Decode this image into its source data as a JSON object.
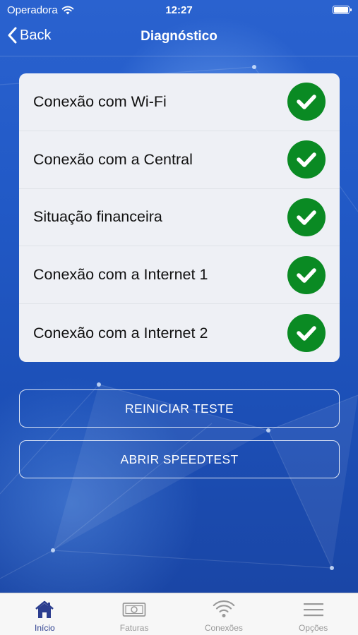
{
  "status_bar": {
    "carrier": "Operadora",
    "time": "12:27"
  },
  "navbar": {
    "back_label": "Back",
    "title": "Diagnóstico"
  },
  "checks": [
    {
      "label": "Conexão com Wi-Fi",
      "status": "ok"
    },
    {
      "label": "Conexão com a Central",
      "status": "ok"
    },
    {
      "label": "Situação financeira",
      "status": "ok"
    },
    {
      "label": "Conexão com a Internet 1",
      "status": "ok"
    },
    {
      "label": "Conexão com a Internet 2",
      "status": "ok"
    }
  ],
  "buttons": {
    "restart": "REINICIAR TESTE",
    "speedtest": "ABRIR SPEEDTEST"
  },
  "tabs": [
    {
      "label": "Início",
      "icon": "home-icon",
      "active": true
    },
    {
      "label": "Faturas",
      "icon": "invoice-icon",
      "active": false
    },
    {
      "label": "Conexões",
      "icon": "wifi-icon",
      "active": false
    },
    {
      "label": "Opções",
      "icon": "menu-icon",
      "active": false
    }
  ],
  "colors": {
    "check_green": "#0a8a23",
    "active_tab": "#2c3e8f",
    "background_blue": "#2159c6"
  }
}
